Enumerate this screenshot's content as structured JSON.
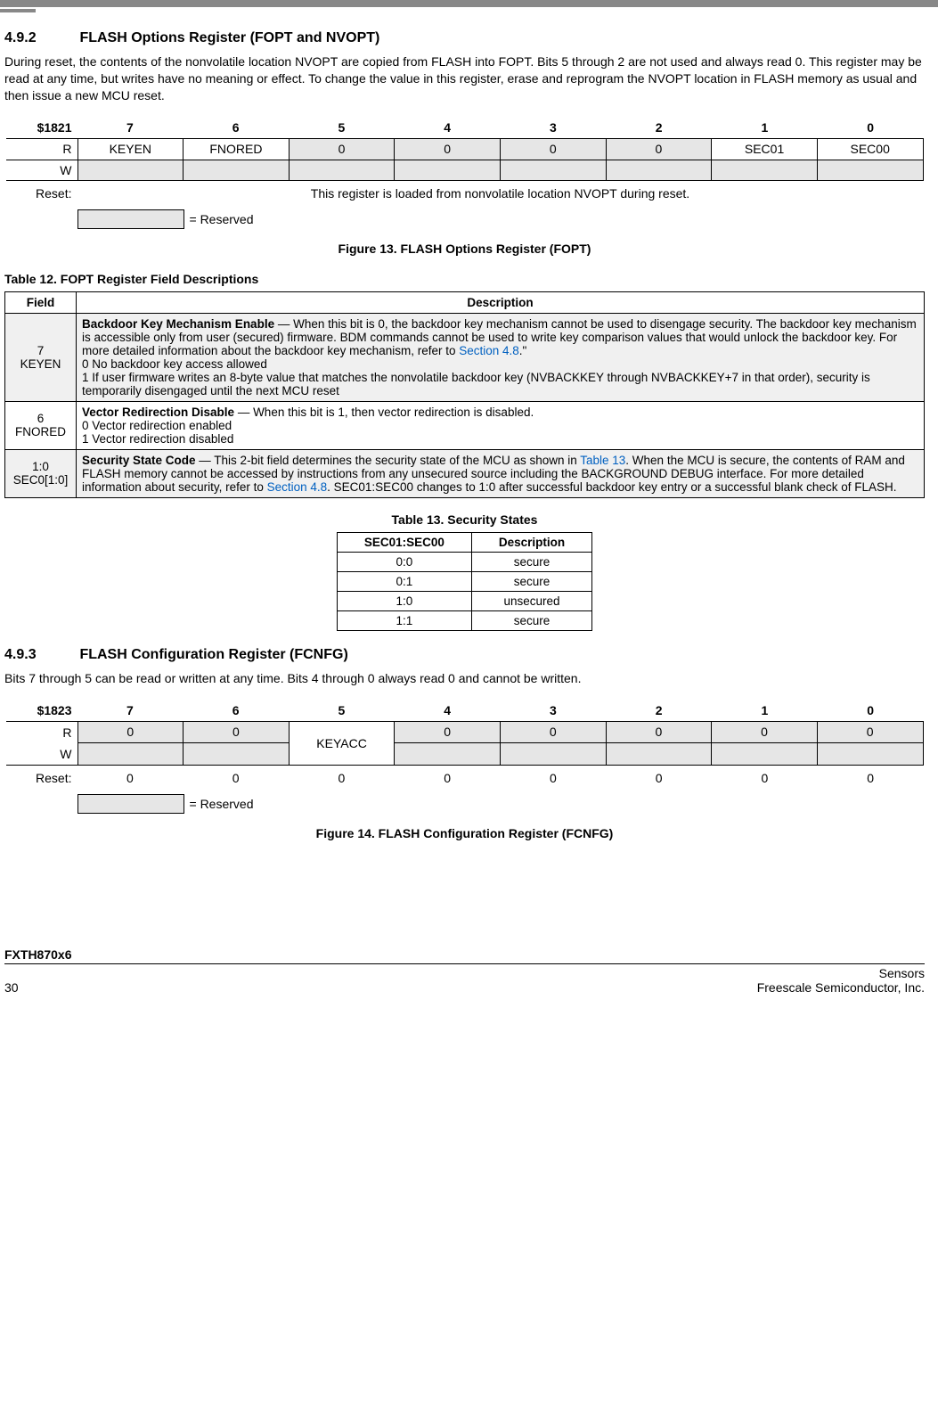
{
  "section1": {
    "num": "4.9.2",
    "title": "FLASH Options Register (FOPT and NVOPT)",
    "para": "During reset, the contents of the nonvolatile location NVOPT are copied from FLASH into FOPT. Bits 5 through 2 are not used and always read 0. This register may be read at any time, but writes have no meaning or effect. To change the value in this register, erase and reprogram the NVOPT location in FLASH memory as usual and then issue a new MCU reset."
  },
  "fig13": {
    "addr": "$1821",
    "bits": [
      "7",
      "6",
      "5",
      "4",
      "3",
      "2",
      "1",
      "0"
    ],
    "r_row": [
      "KEYEN",
      "FNORED",
      "0",
      "0",
      "0",
      "0",
      "SEC01",
      "SEC00"
    ],
    "r_label": "R",
    "w_label": "W",
    "reset_label": "Reset:",
    "reset_text": "This register is loaded from nonvolatile location NVOPT during reset.",
    "reserved_label": "= Reserved",
    "caption": "Figure 13. FLASH Options Register (FOPT)"
  },
  "table12": {
    "title": "Table 12. FOPT Register Field Descriptions",
    "head": [
      "Field",
      "Description"
    ],
    "rows": [
      {
        "field1": "7",
        "field2": "KEYEN",
        "title": "Backdoor Key Mechanism Enable",
        "body1": " — When this bit is 0, the backdoor key mechanism cannot be used to disengage security. The backdoor key mechanism is accessible only from user (secured) firmware. BDM commands cannot be used to write key comparison values that would unlock the backdoor key. For more detailed information about the backdoor key mechanism, refer to ",
        "link": "Section 4.8",
        "body2": ".\"",
        "opt0": "0   No backdoor key access allowed",
        "opt1": "1   If user firmware writes an 8-byte value that matches the nonvolatile backdoor key (NVBACKKEY through NVBACKKEY+7 in that order), security is temporarily disengaged until the next MCU reset"
      },
      {
        "field1": "6",
        "field2": "FNORED",
        "title": "Vector Redirection Disable",
        "body1": " — When this bit is 1, then vector redirection is disabled.",
        "opt0": "0   Vector redirection enabled",
        "opt1": "1   Vector redirection disabled"
      },
      {
        "field1": "1:0",
        "field2": "SEC0[1:0]",
        "title": "Security State Code",
        "body1": " — This 2-bit field determines the security state of the MCU as shown in ",
        "link1": "Table 13",
        "body2": ". When the MCU is secure, the contents of RAM and FLASH memory cannot be accessed by instructions from any unsecured source including the BACKGROUND DEBUG interface. For more detailed information about security, refer to ",
        "link2": "Section 4.8",
        "body3": ". SEC01:SEC00 changes to 1:0 after successful backdoor key entry or a successful blank check of FLASH."
      }
    ]
  },
  "table13": {
    "title": "Table 13. Security States",
    "head": [
      "SEC01:SEC00",
      "Description"
    ],
    "rows": [
      [
        "0:0",
        "secure"
      ],
      [
        "0:1",
        "secure"
      ],
      [
        "1:0",
        "unsecured"
      ],
      [
        "1:1",
        "secure"
      ]
    ]
  },
  "section2": {
    "num": "4.9.3",
    "title": "FLASH Configuration Register (FCNFG)",
    "para": "Bits 7 through 5 can be read or written at any time. Bits 4 through 0 always read 0 and cannot be written."
  },
  "fig14": {
    "addr": "$1823",
    "bits": [
      "7",
      "6",
      "5",
      "4",
      "3",
      "2",
      "1",
      "0"
    ],
    "r_row": [
      "0",
      "0",
      "",
      "0",
      "0",
      "0",
      "0",
      "0"
    ],
    "keyacc": "KEYACC",
    "r_label": "R",
    "w_label": "W",
    "reset_label": "Reset:",
    "reset_vals": [
      "0",
      "0",
      "0",
      "0",
      "0",
      "0",
      "0",
      "0"
    ],
    "reserved_label": "= Reserved",
    "caption": "Figure 14. FLASH Configuration Register (FCNFG)"
  },
  "footer": {
    "product": "FXTH870x6",
    "right1": "Sensors",
    "page": "30",
    "right2": "Freescale Semiconductor, Inc."
  }
}
